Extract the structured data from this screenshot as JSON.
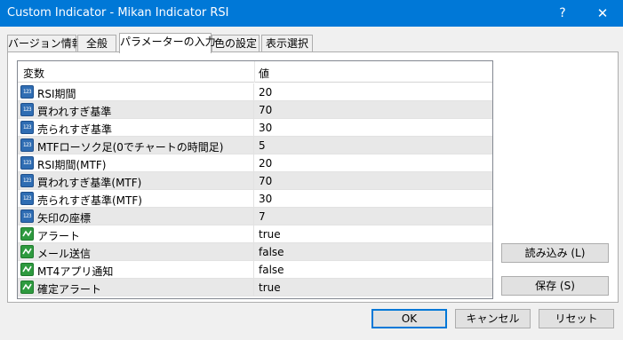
{
  "window": {
    "title": "Custom Indicator - Mikan Indicator RSI",
    "help_label": "?",
    "close_label": "✕"
  },
  "tabs": [
    {
      "label": "バージョン情報"
    },
    {
      "label": "全般"
    },
    {
      "label": "パラメーターの入力"
    },
    {
      "label": "色の設定"
    },
    {
      "label": "表示選択"
    }
  ],
  "table": {
    "columns": {
      "variable": "変数",
      "value": "値"
    },
    "rows": [
      {
        "name": "RSI期間",
        "value": "20",
        "type": "number"
      },
      {
        "name": "買われすぎ基準",
        "value": "70",
        "type": "number"
      },
      {
        "name": "売られすぎ基準",
        "value": "30",
        "type": "number"
      },
      {
        "name": "MTFローソク足(0でチャートの時間足)",
        "value": "5",
        "type": "number"
      },
      {
        "name": "RSI期間(MTF)",
        "value": "20",
        "type": "number"
      },
      {
        "name": "買われすぎ基準(MTF)",
        "value": "70",
        "type": "number"
      },
      {
        "name": "売られすぎ基準(MTF)",
        "value": "30",
        "type": "number"
      },
      {
        "name": "矢印の座標",
        "value": "7",
        "type": "number"
      },
      {
        "name": "アラート",
        "value": "true",
        "type": "bool"
      },
      {
        "name": "メール送信",
        "value": "false",
        "type": "bool"
      },
      {
        "name": "MT4アプリ通知",
        "value": "false",
        "type": "bool"
      },
      {
        "name": "確定アラート",
        "value": "true",
        "type": "bool"
      }
    ]
  },
  "icons": {
    "number": "123",
    "bool": "bool-icon"
  },
  "buttons": {
    "load": "読み込み (L)",
    "save": "保存 (S)",
    "ok": "OK",
    "cancel": "キャンセル",
    "reset": "リセット"
  },
  "colors": {
    "titlebar": "#0078d7",
    "number_icon": "#2f6db3",
    "bool_icon": "#2e9a3f"
  }
}
